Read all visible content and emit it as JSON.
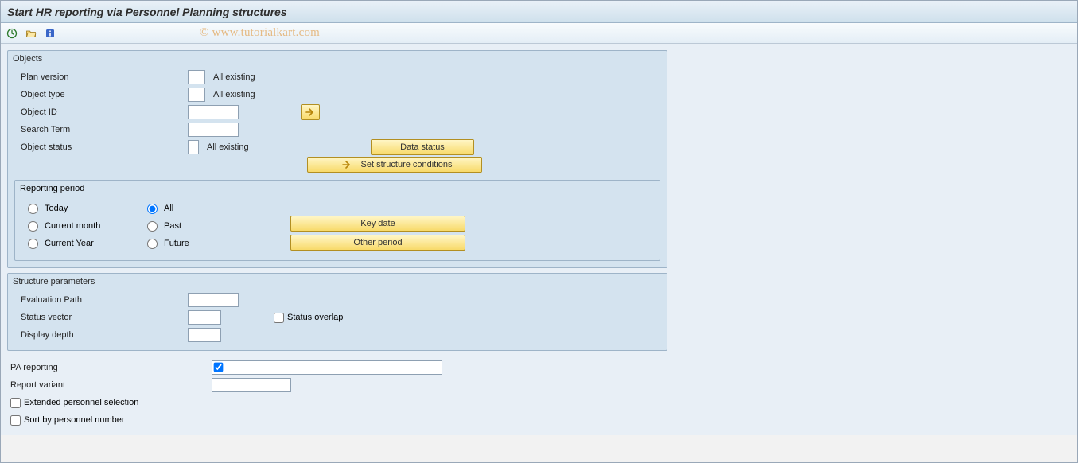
{
  "title": "Start HR reporting via Personnel Planning structures",
  "watermark": "© www.tutorialkart.com",
  "toolbar": {
    "execute_tip": "Execute",
    "variant_tip": "Get Variant",
    "info_tip": "Information"
  },
  "objects": {
    "title": "Objects",
    "plan_version_label": "Plan version",
    "plan_version_value": "",
    "plan_version_after": "All existing",
    "object_type_label": "Object type",
    "object_type_value": "",
    "object_type_after": "All existing",
    "object_id_label": "Object ID",
    "object_id_value": "",
    "search_term_label": "Search Term",
    "search_term_value": "",
    "object_status_label": "Object status",
    "object_status_value": "",
    "object_status_after": "All existing",
    "data_status_btn": "Data status",
    "set_structure_btn": "Set structure conditions"
  },
  "period": {
    "title": "Reporting period",
    "today": "Today",
    "current_month": "Current month",
    "current_year": "Current Year",
    "all": "All",
    "past": "Past",
    "future": "Future",
    "key_date_btn": "Key date",
    "other_period_btn": "Other period",
    "selected": "all"
  },
  "struct": {
    "title": "Structure parameters",
    "eval_path_label": "Evaluation Path",
    "eval_path_value": "",
    "status_vector_label": "Status vector",
    "status_vector_value": "",
    "status_overlap_label": "Status overlap",
    "display_depth_label": "Display depth",
    "display_depth_value": ""
  },
  "bottom": {
    "pa_reporting_label": "PA reporting",
    "pa_reporting_value": "",
    "pa_reporting_checked": true,
    "report_variant_label": "Report variant",
    "report_variant_value": "",
    "extended_sel_label": "Extended personnel selection",
    "sort_by_pn_label": "Sort by personnel number"
  }
}
